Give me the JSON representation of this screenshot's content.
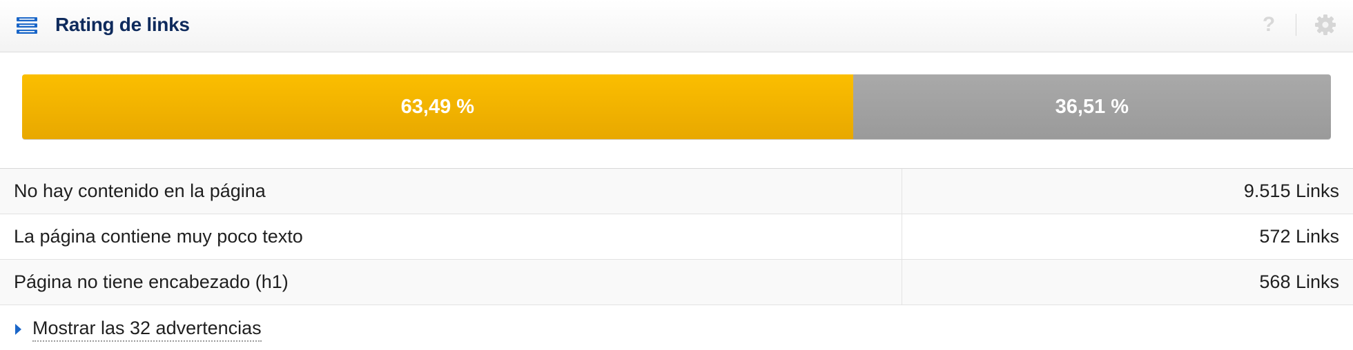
{
  "header": {
    "title": "Rating de links",
    "title_icon": "list-icon",
    "help_icon": "question-icon",
    "help_label": "?",
    "settings_icon": "gear-icon"
  },
  "rating_bar": {
    "segments": [
      {
        "label": "63,49 %",
        "value": 63.49,
        "color": "#f5b400"
      },
      {
        "label": "36,51 %",
        "value": 36.51,
        "color": "#a3a3a3"
      }
    ]
  },
  "table": {
    "rows": [
      {
        "label": "No hay contenido en la página",
        "value": "9.515 Links"
      },
      {
        "label": "La página contiene muy poco texto",
        "value": "572 Links"
      },
      {
        "label": "Página no tiene encabezado (h1)",
        "value": "568 Links"
      }
    ]
  },
  "footer": {
    "show_more_label": "Mostrar las 32 advertencias"
  },
  "colors": {
    "accent": "#1a66c8",
    "title": "#0e2a5c",
    "warning": "#f5b400",
    "neutral": "#a3a3a3"
  }
}
